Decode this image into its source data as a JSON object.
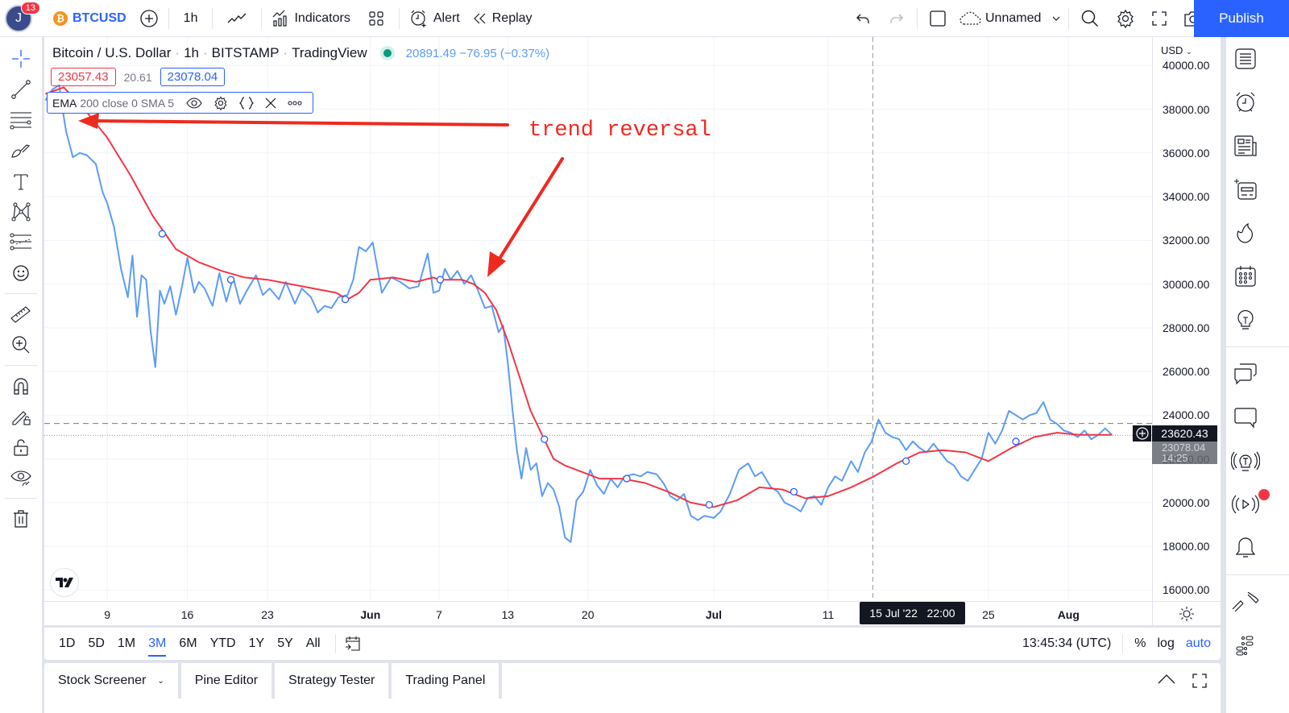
{
  "topbar": {
    "avatar_initial": "J",
    "notification_count": "13",
    "symbol": "BTCUSD",
    "interval": "1h",
    "indicators_label": "Indicators",
    "alert_label": "Alert",
    "replay_label": "Replay",
    "layout_name": "Unnamed",
    "publish_label": "Publish",
    "icons": [
      "add-symbol-icon",
      "chart-type-icon",
      "indicators-icon",
      "layouts-icon",
      "alert-icon",
      "replay-icon",
      "undo-icon",
      "redo-icon",
      "select-layout-icon",
      "cloud-icon",
      "search-icon",
      "settings-icon",
      "fullscreen-icon",
      "snapshot-icon"
    ]
  },
  "legend": {
    "title": "Bitcoin / U.S. Dollar",
    "interval": "1h",
    "exchange": "BITSTAMP",
    "source": "TradingView",
    "quote": "20891.49 −76.95 (−0.37%)",
    "bid": "23057.43",
    "spread": "20.61",
    "ask": "23078.04",
    "indicator_name": "EMA",
    "indicator_params": "200 close 0 SMA 5"
  },
  "annotation": {
    "text": "trend reversal",
    "color": "#ee2a20"
  },
  "price_axis": {
    "currency": "USD",
    "current_price": "23620.43",
    "last_price": "23078.04",
    "countdown": "14:25"
  },
  "crosshair": {
    "time_label": "15 Jul '22   22:00"
  },
  "range_bar": {
    "ranges": [
      "1D",
      "5D",
      "1M",
      "3M",
      "6M",
      "YTD",
      "1Y",
      "5Y",
      "All"
    ],
    "active": "3M",
    "clock": "13:45:34 (UTC)",
    "percent_label": "%",
    "log_label": "log",
    "auto_label": "auto"
  },
  "bottom_panel": {
    "tabs": [
      "Stock Screener",
      "Pine Editor",
      "Strategy Tester",
      "Trading Panel"
    ]
  },
  "colors": {
    "accent": "#2962ff",
    "price_line": "#5b9cf6",
    "ema_line": "#f23645",
    "bid": "#f23645",
    "ask": "#2962ff",
    "positive_dot": "#089981"
  },
  "chart_data": {
    "type": "line",
    "title": "Bitcoin / U.S. Dollar · 1h · BITSTAMP",
    "xlabel": "",
    "ylabel": "USD",
    "ylim": [
      15500,
      41300
    ],
    "yticks": [
      40000,
      38000,
      36000,
      34000,
      32000,
      30000,
      28000,
      26000,
      24000,
      22000,
      20000,
      18000,
      16000
    ],
    "ytick_labels": [
      "40000.00",
      "38000.00",
      "36000.00",
      "34000.00",
      "32000.00",
      "30000.00",
      "28000.00",
      "26000.00",
      "24000.00",
      "22000.00",
      "20000.00",
      "18000.00",
      "16000.00"
    ],
    "xtick_labels": [
      "9",
      "16",
      "23",
      "Jun",
      "7",
      "13",
      "20",
      "Jul",
      "11",
      "25",
      "Aug"
    ],
    "xtick_days": [
      9,
      16,
      23,
      32,
      38,
      44,
      51,
      62,
      72,
      86,
      93
    ],
    "xrange_days": [
      3.5,
      100.3
    ],
    "grid": true,
    "series": [
      {
        "name": "BTCUSD close",
        "color": "#5b9cf6",
        "x_days": [
          3.6,
          4.2,
          4.8,
          5.0,
          5.4,
          6.0,
          6.6,
          7.2,
          8.0,
          8.6,
          9.0,
          9.6,
          10.2,
          10.8,
          11.2,
          11.6,
          12.0,
          12.4,
          12.8,
          13.2,
          13.6,
          14.0,
          14.5,
          15.0,
          15.5,
          16.0,
          16.6,
          17.0,
          17.5,
          18.2,
          18.8,
          19.4,
          20.0,
          20.6,
          21.2,
          22.0,
          22.6,
          23.2,
          24.0,
          24.6,
          25.4,
          26.0,
          26.8,
          27.4,
          28.0,
          28.6,
          29.2,
          30.0,
          30.5,
          31.0,
          31.6,
          32.2,
          33.0,
          33.8,
          34.6,
          35.4,
          36.2,
          37.0,
          37.5,
          38.0,
          38.5,
          39.0,
          39.6,
          40.2,
          40.8,
          41.4,
          42.0,
          42.6,
          43.2,
          43.6,
          44.0,
          44.4,
          44.8,
          45.2,
          45.6,
          46.0,
          46.5,
          47.0,
          47.5,
          48.0,
          48.5,
          49.0,
          49.5,
          50.0,
          50.6,
          51.2,
          51.8,
          52.4,
          53.0,
          53.6,
          54.2,
          55.0,
          55.6,
          56.2,
          57.0,
          57.6,
          58.2,
          58.8,
          59.4,
          60.0,
          60.6,
          61.2,
          62.0,
          62.6,
          63.4,
          64.2,
          65.0,
          65.6,
          66.2,
          67.0,
          67.6,
          68.2,
          69.0,
          69.6,
          70.2,
          70.8,
          71.4,
          72.0,
          72.6,
          73.2,
          74.0,
          74.6,
          75.2,
          75.8,
          76.4,
          77.0,
          77.6,
          78.2,
          78.8,
          79.4,
          80.0,
          80.6,
          81.2,
          81.8,
          82.4,
          83.0,
          83.6,
          84.2,
          84.8,
          85.4,
          86.0,
          86.6,
          87.2,
          87.8,
          88.4,
          89.0,
          89.6,
          90.2,
          90.8,
          91.4,
          92.0,
          92.6,
          93.2,
          93.8,
          94.4,
          95.0,
          95.6,
          96.2,
          96.8
        ],
        "values": [
          38400,
          38900,
          39100,
          38300,
          37000,
          35800,
          36000,
          35900,
          35500,
          34200,
          33700,
          32600,
          30700,
          29400,
          31300,
          28500,
          30400,
          30200,
          27800,
          26200,
          29700,
          29100,
          29900,
          28600,
          29800,
          31200,
          29600,
          30100,
          29800,
          29000,
          30500,
          29200,
          30300,
          29100,
          29700,
          30400,
          29500,
          29800,
          29300,
          30100,
          29100,
          29800,
          29400,
          28700,
          29000,
          28900,
          29400,
          29500,
          30200,
          31700,
          31500,
          31900,
          29600,
          30300,
          30100,
          29800,
          29900,
          31400,
          29600,
          29700,
          30700,
          30200,
          30600,
          30000,
          30400,
          29700,
          28900,
          29000,
          27800,
          28100,
          26400,
          24300,
          22400,
          21100,
          22500,
          21500,
          21800,
          20300,
          20900,
          20600,
          19800,
          18400,
          18200,
          20100,
          20500,
          21500,
          20800,
          20400,
          21100,
          20700,
          21200,
          21300,
          21200,
          21400,
          21300,
          20900,
          20300,
          20100,
          20400,
          19400,
          19200,
          19400,
          19300,
          19600,
          20400,
          21500,
          21800,
          21200,
          21400,
          20700,
          20500,
          20000,
          19800,
          19600,
          20200,
          20300,
          19900,
          20700,
          21200,
          21000,
          21900,
          21400,
          22300,
          22800,
          23800,
          23200,
          23000,
          22900,
          22400,
          22800,
          22500,
          22300,
          22700,
          22300,
          21900,
          21700,
          21200,
          21000,
          21500,
          22000,
          23200,
          22700,
          23300,
          24200,
          24000,
          23800,
          24000,
          24100,
          24600,
          23800,
          23600,
          23300,
          23200,
          23000,
          23300,
          22900,
          23100,
          23400,
          23100
        ]
      },
      {
        "name": "EMA 200",
        "color": "#f23645",
        "x_days": [
          3.6,
          5.2,
          7.0,
          9.0,
          11.0,
          13.0,
          15.0,
          17.0,
          19.0,
          21.0,
          23.0,
          25.0,
          27.0,
          29.0,
          30.0,
          31.0,
          32.0,
          34.0,
          36.0,
          37.5,
          38.0,
          39.0,
          40.0,
          41.0,
          42.0,
          43.0,
          44.0,
          45.0,
          46.0,
          47.0,
          48.0,
          49.0,
          50.0,
          51.0,
          52.0,
          54.0,
          56.0,
          58.0,
          60.0,
          62.0,
          64.0,
          66.0,
          68.0,
          70.0,
          72.0,
          74.0,
          76.0,
          78.0,
          80.0,
          82.0,
          84.0,
          86.0,
          88.0,
          90.0,
          92.0,
          94.0,
          96.8
        ],
        "values": [
          38700,
          39000,
          38000,
          36700,
          35000,
          33100,
          31600,
          31000,
          30600,
          30300,
          30200,
          30000,
          29800,
          29600,
          29300,
          29600,
          30200,
          30300,
          30100,
          30300,
          30200,
          30200,
          30200,
          30000,
          29600,
          28800,
          27400,
          25800,
          24200,
          23100,
          22000,
          21700,
          21500,
          21300,
          21100,
          21100,
          20900,
          20500,
          20000,
          19800,
          20100,
          20700,
          20600,
          20200,
          20300,
          20700,
          21200,
          21800,
          22300,
          22400,
          22300,
          21900,
          22500,
          23000,
          23200,
          23100,
          23100
        ]
      }
    ],
    "markers": [
      {
        "series": "EMA 200",
        "x_day": 13.8,
        "value": 32300
      },
      {
        "series": "EMA 200",
        "x_day": 19.8,
        "value": 30200
      },
      {
        "series": "EMA 200",
        "x_day": 29.8,
        "value": 29300
      },
      {
        "series": "EMA 200",
        "x_day": 38.1,
        "value": 30200
      },
      {
        "series": "EMA 200",
        "x_day": 47.2,
        "value": 22900
      },
      {
        "series": "EMA 200",
        "x_day": 54.4,
        "value": 21100
      },
      {
        "series": "EMA 200",
        "x_day": 61.6,
        "value": 19900
      },
      {
        "series": "EMA 200",
        "x_day": 69.0,
        "value": 20500
      },
      {
        "series": "EMA 200",
        "x_day": 78.8,
        "value": 21900
      },
      {
        "series": "EMA 200",
        "x_day": 88.4,
        "value": 22800
      }
    ],
    "annotations": [
      {
        "text": "trend reversal",
        "type": "arrow",
        "points_to_day": 39.5,
        "points_to_value": 31200
      },
      {
        "text": "",
        "type": "arrow",
        "points_to_day": 4.6,
        "points_to_value": 38900
      }
    ],
    "horizontal_lines": [
      {
        "value": 23620.43,
        "style": "dashed"
      },
      {
        "value": 23078.04,
        "style": "dotted"
      }
    ],
    "crosshair_x_day": 75.9
  }
}
